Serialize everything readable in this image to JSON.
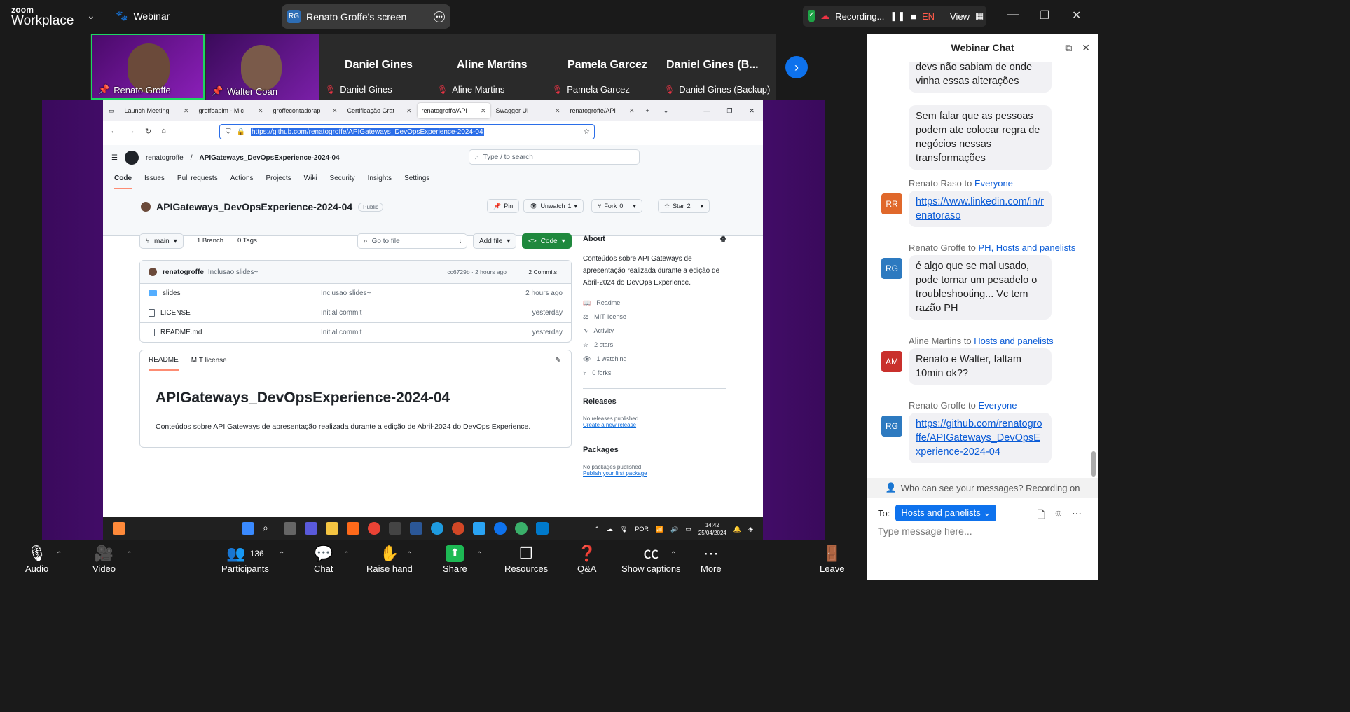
{
  "top": {
    "brand_line1": "zoom",
    "brand_line2": "Workplace",
    "webinar": "Webinar",
    "screen_initials": "RG",
    "screen_label": "Renato Groffe's screen",
    "recording": "Recording...",
    "lang": "EN",
    "view": "View"
  },
  "thumbs": {
    "v1": "Renato Groffe",
    "v2": "Walter Coan",
    "tiles": [
      {
        "big": "Daniel Gines",
        "small": "Daniel Gines"
      },
      {
        "big": "Aline Martins",
        "small": "Aline Martins"
      },
      {
        "big": "Pamela Garcez",
        "small": "Pamela Garcez"
      },
      {
        "big": "Daniel Gines (B...",
        "small": "Daniel Gines (Backup)"
      }
    ]
  },
  "browser": {
    "tabs": [
      "Launch Meeting",
      "groffeapim - Mic",
      "groffecontadorap",
      "Certificação Grat",
      "renatogroffe/API",
      "Swagger UI",
      "renatogroffe/API"
    ],
    "url": "https://github.com/renatogroffe/APIGateways_DevOpsExperience-2024-04",
    "owner": "renatogroffe",
    "sep": "/",
    "repo": "APIGateways_DevOpsExperience-2024-04",
    "search": "Type / to search",
    "repotabs": [
      "Code",
      "Issues",
      "Pull requests",
      "Actions",
      "Projects",
      "Wiki",
      "Security",
      "Insights",
      "Settings"
    ],
    "title": "APIGateways_DevOpsExperience-2024-04",
    "public": "Public",
    "pin": "Pin",
    "unwatch": "Unwatch",
    "unwatch_count": "1",
    "fork": "Fork",
    "fork_count": "0",
    "star": "Star",
    "star_count": "2",
    "branch": "main",
    "branches": "1 Branch",
    "tags": "0 Tags",
    "gotofile": "Go to file",
    "gotofile_key": "t",
    "addfile": "Add file",
    "code": "Code",
    "commit_author": "renatogroffe",
    "commit_msg": "Inclusao slides~",
    "commit_hash": "cc6729b · 2 hours ago",
    "commits": "2 Commits",
    "files": [
      {
        "name": "slides",
        "msg": "Inclusao slides~",
        "when": "2 hours ago"
      },
      {
        "name": "LICENSE",
        "msg": "Initial commit",
        "when": "yesterday"
      },
      {
        "name": "README.md",
        "msg": "Initial commit",
        "when": "yesterday"
      }
    ],
    "readme_tab": "README",
    "license_tab": "MIT license",
    "readme_h1": "APIGateways_DevOpsExperience-2024-04",
    "readme_p": "Conteúdos sobre API Gateways de apresentação realizada durante a edição de Abril-2024 do DevOps Experience.",
    "about_h": "About",
    "about_desc": "Conteúdos sobre API Gateways de apresentação realizada durante a edição de Abril-2024 do DevOps Experience.",
    "about_items": [
      "Readme",
      "MIT license",
      "Activity",
      "2 stars",
      "1 watching",
      "0 forks"
    ],
    "releases_h": "Releases",
    "releases_none": "No releases published",
    "releases_link": "Create a new release",
    "packages_h": "Packages",
    "packages_none": "No packages published",
    "packages_link": "Publish your first package"
  },
  "taskbar": {
    "lang": "POR",
    "time": "14:42",
    "date": "25/04/2024"
  },
  "bottom": {
    "audio": "Audio",
    "video": "Video",
    "participants": "Participants",
    "participants_count": "136",
    "chat": "Chat",
    "raise": "Raise hand",
    "share": "Share",
    "resources": "Resources",
    "qa": "Q&A",
    "captions": "Show captions",
    "more": "More",
    "leave": "Leave"
  },
  "chat": {
    "title": "Webinar Chat",
    "m0": "devs não sabiam de onde vinha essas alterações",
    "m1": "Sem falar que as pessoas podem ate colocar regra de negócios nessas transformações",
    "s2_name": "Renato Raso",
    "s2_to": "to",
    "s2_dest": "Everyone",
    "a2": "RR",
    "m2": "https://www.linkedin.com/in/renatoraso",
    "s3_name": "Renato Groffe",
    "s3_to": "to",
    "s3_dest": "PH, Hosts and panelists",
    "a3": "RG",
    "m3": "é algo que se mal usado, pode tornar um pesadelo o troubleshooting... Vc tem razão PH",
    "s4_name": "Aline Martins",
    "s4_to": "to",
    "s4_dest": "Hosts and panelists",
    "a4": "AM",
    "m4": "Renato e Walter, faltam 10min ok??",
    "s5_name": "Renato Groffe",
    "s5_to": "to",
    "s5_dest": "Everyone",
    "a5": "RG",
    "m5": "https://github.com/renatogroffe/APIGateways_DevOpsExperience-2024-04",
    "who": "Who can see your messages? Recording on",
    "to_label": "To:",
    "to_value": "Hosts and panelists",
    "placeholder": "Type message here..."
  }
}
